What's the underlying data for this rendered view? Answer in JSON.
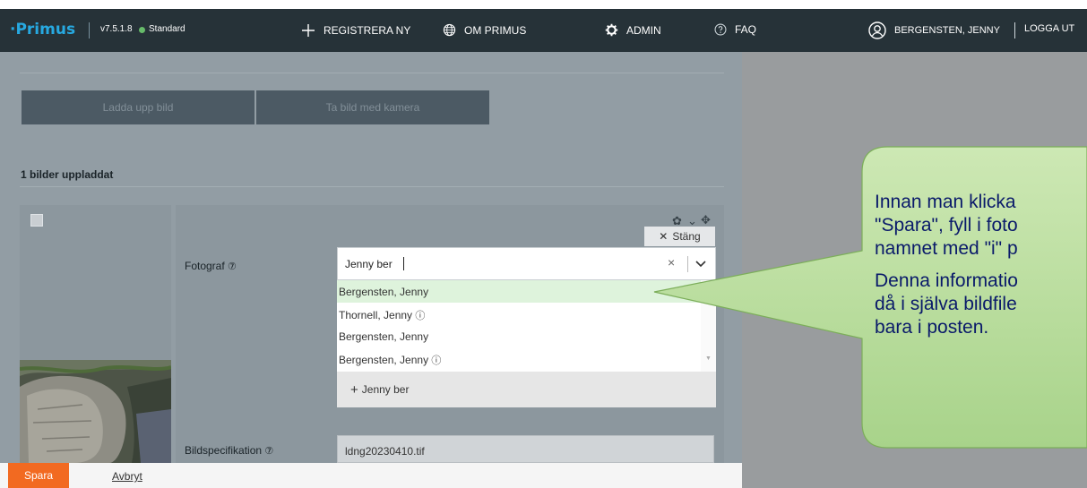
{
  "header": {
    "logo": "Primus",
    "version": "v7.5.1.8",
    "level": "Standard",
    "nav": [
      {
        "label": "REGISTRERA NY",
        "icon": "plus-icon"
      },
      {
        "label": "OM PRIMUS",
        "icon": "globe-icon"
      },
      {
        "label": "ADMIN",
        "icon": "gear-icon"
      },
      {
        "label": "FAQ",
        "icon": "help-icon"
      }
    ],
    "user": "BERGENSTEN, JENNY",
    "logout": "LOGGA UT"
  },
  "upload": {
    "upload_label": "Ladda upp bild",
    "camera_label": "Ta bild med kamera",
    "uploaded_count": "1 bilder uppladdat"
  },
  "form": {
    "close_label": "Stäng",
    "photographer_label": "Fotograf",
    "photographer_input": "Jenny ber",
    "options": [
      {
        "label": "Bergensten, Jenny",
        "info": false
      },
      {
        "label": "Thornell, Jenny",
        "info": true
      },
      {
        "label": "Bergensten, Jenny",
        "info": false
      },
      {
        "label": "Bergensten, Jenny",
        "info": true
      }
    ],
    "add_new": "Jenny ber",
    "spec_label": "Bildspecifikation",
    "spec_value": "ldng20230410.tif"
  },
  "footer": {
    "save": "Spara",
    "cancel": "Avbryt"
  },
  "callout": {
    "paragraph1": [
      "Innan man klicka",
      "\"Spara\", fyll i foto",
      "namnet med \"i\" p"
    ],
    "paragraph2": [
      "Denna informatio",
      "då i själva bildfile",
      "bara i posten."
    ]
  },
  "colors": {
    "header_bg": "#263238",
    "logo": "#27a9e1",
    "status_dot": "#66bb6a",
    "save_button": "#f26a21",
    "highlight": "#def3dc",
    "callout_fill": "#b9dc9a",
    "callout_text": "#0a1a6a"
  }
}
